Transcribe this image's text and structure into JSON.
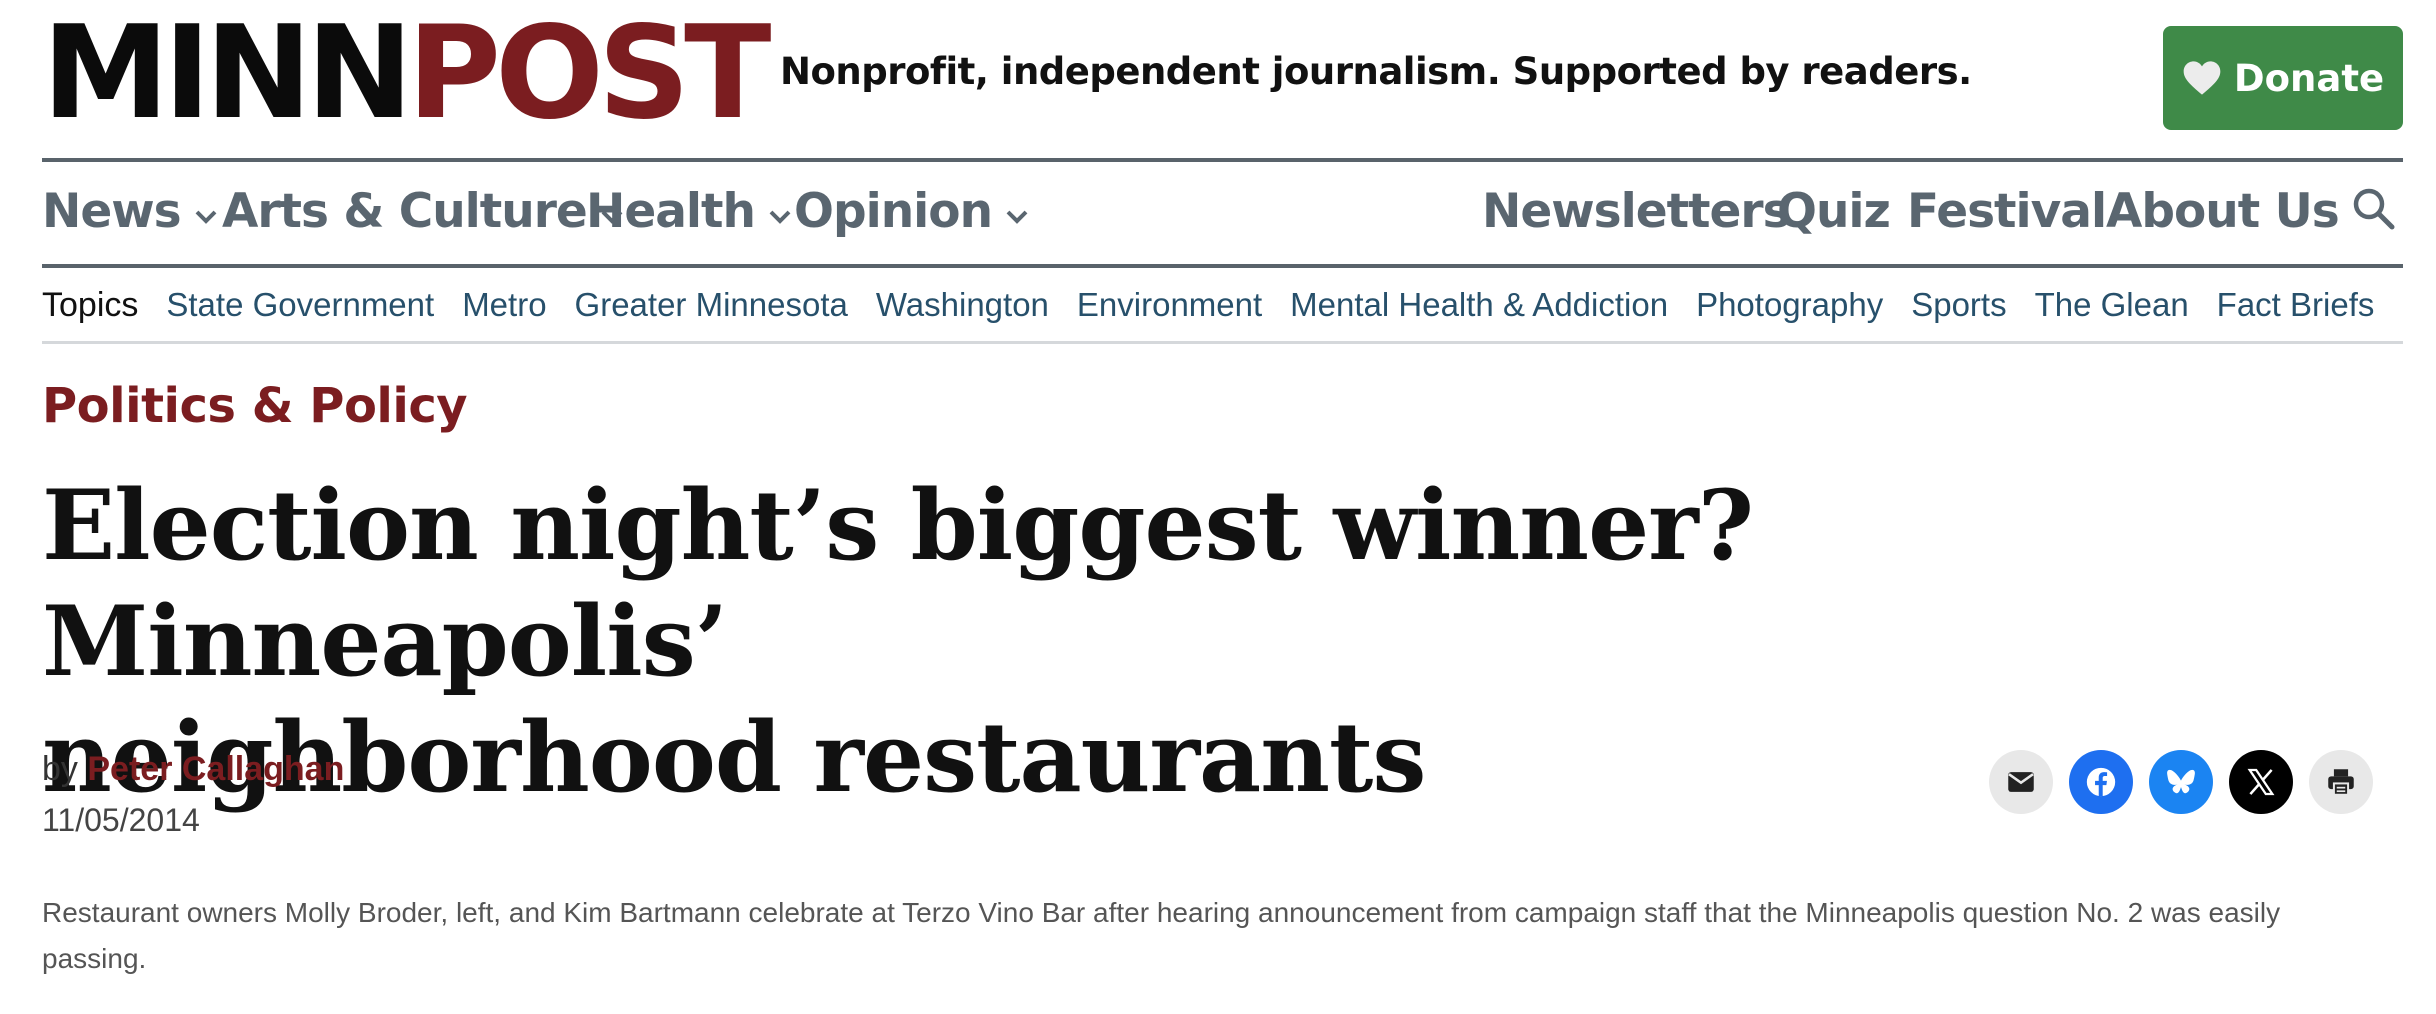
{
  "header": {
    "logo_part1": "MINN",
    "logo_part2": "POST",
    "tagline": "Nonprofit, independent journalism. Supported by readers.",
    "donate_label": "Donate",
    "donate_icon": "heart-icon"
  },
  "nav": {
    "left_items": [
      {
        "label": "News",
        "has_dropdown": true
      },
      {
        "label": "Arts & Culture",
        "has_dropdown": true
      },
      {
        "label": "Health",
        "has_dropdown": true
      },
      {
        "label": "Opinion",
        "has_dropdown": true
      }
    ],
    "right_items": [
      {
        "label": "Newsletters"
      },
      {
        "label": "Quiz"
      },
      {
        "label": "Festival"
      },
      {
        "label": "About Us"
      }
    ],
    "search_icon": "search-icon"
  },
  "topics": {
    "label": "Topics",
    "items": [
      "State Government",
      "Metro",
      "Greater Minnesota",
      "Washington",
      "Environment",
      "Mental Health & Addiction",
      "Photography",
      "Sports",
      "The Glean",
      "Fact Briefs"
    ]
  },
  "article": {
    "category": "Politics & Policy",
    "headline_line1": "Election night’s biggest winner? Minneapolis’",
    "headline_line2": "neighborhood restaurants",
    "by_prefix": "by",
    "author": "Peter Callaghan",
    "date": "11/05/2014",
    "caption": "Restaurant owners Molly Broder, left, and Kim Bartmann celebrate at Terzo Vino Bar after hearing announcement from campaign staff that the Minneapolis question No. 2 was easily passing."
  },
  "share": {
    "icons": [
      "email-icon",
      "facebook-icon",
      "bluesky-icon",
      "x-icon",
      "print-icon"
    ]
  },
  "colors": {
    "brand_red": "#7b1d20",
    "donate_green": "#3f8a48",
    "nav_gray": "#5a6670",
    "topic_blue": "#27506b"
  }
}
